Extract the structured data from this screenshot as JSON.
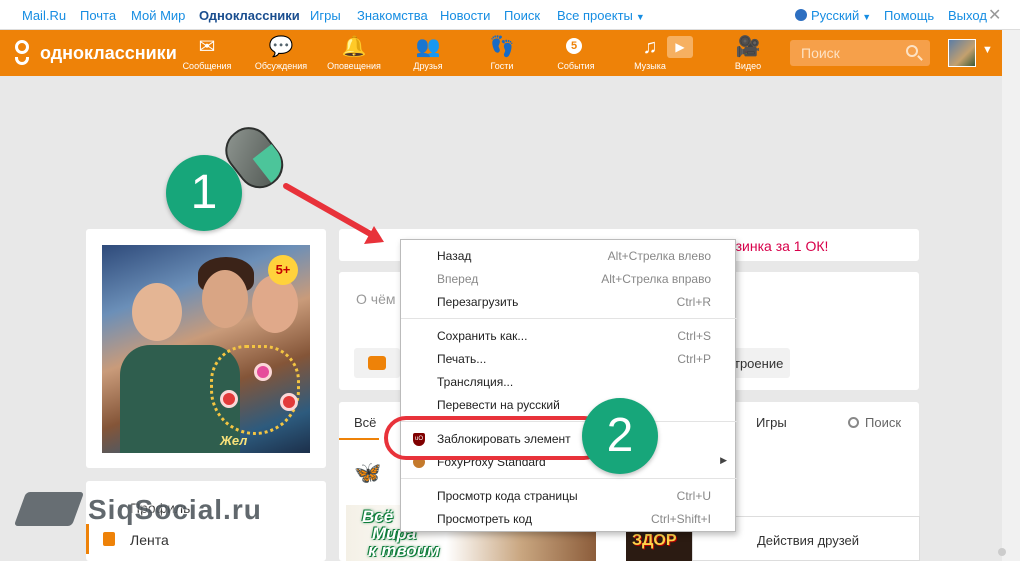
{
  "topbar": {
    "links": [
      "Mail.Ru",
      "Почта",
      "Мой Мир",
      "Одноклассники",
      "Игры",
      "Знакомства",
      "Новости",
      "Поиск",
      "Все проекты"
    ],
    "language": "Русский",
    "help": "Помощь",
    "logout": "Выход"
  },
  "okbar": {
    "brand": "одноклассники",
    "nav": [
      {
        "label": "Сообщения",
        "icon": "envelope-icon"
      },
      {
        "label": "Обсуждения",
        "icon": "chat-bubbles-icon"
      },
      {
        "label": "Оповещения",
        "icon": "bell-icon"
      },
      {
        "label": "Друзья",
        "icon": "friends-icon"
      },
      {
        "label": "Гости",
        "icon": "footprints-icon"
      },
      {
        "label": "События",
        "icon": "events-icon"
      },
      {
        "label": "Музыка",
        "icon": "music-note-icon"
      },
      {
        "label": "Видео",
        "icon": "video-camera-icon"
      }
    ],
    "events_badge": "5",
    "search_placeholder": "Поиск"
  },
  "profile": {
    "badge": "5+",
    "signature": "Жел",
    "menu": [
      "Профиль",
      "Лента"
    ]
  },
  "feed": {
    "promo": "рзинка за 1 ОК!",
    "status_placeholder": "О чём",
    "mood_btn": "троение",
    "tabs": [
      "Всё",
      "Игры"
    ],
    "search": "Поиск",
    "ad_text_lines": [
      "Всё",
      "Мира",
      "к твоим"
    ],
    "ad2_text": "ЗДОР",
    "friends_actions": "Действия друзей"
  },
  "context_menu": {
    "items": [
      {
        "label": "Назад",
        "shortcut": "Alt+Стрелка влево"
      },
      {
        "label": "Вперед",
        "shortcut": "Alt+Стрелка вправо",
        "disabled": true
      },
      {
        "label": "Перезагрузить",
        "shortcut": "Ctrl+R"
      },
      {
        "label": "Сохранить как...",
        "shortcut": "Ctrl+S"
      },
      {
        "label": "Печать...",
        "shortcut": "Ctrl+P"
      },
      {
        "label": "Трансляция...",
        "shortcut": ""
      },
      {
        "label": "Перевести на русский",
        "shortcut": ""
      },
      {
        "label": "Заблокировать элемент",
        "shortcut": "",
        "icon": "ublock-icon"
      },
      {
        "label": "FoxyProxy Standard",
        "shortcut": "",
        "icon": "foxyproxy-icon",
        "submenu": true
      },
      {
        "label": "Просмотр кода страницы",
        "shortcut": "Ctrl+U"
      },
      {
        "label": "Просмотреть код",
        "shortcut": "Ctrl+Shift+I"
      }
    ],
    "ublock_icon_text": "uO"
  },
  "annotations": {
    "step1": "1",
    "step2": "2"
  },
  "watermark": "SiqSocial.ru",
  "colors": {
    "ok_orange": "#ee8208",
    "mailru_blue": "#168de2",
    "annotation_green": "#17a67a",
    "annotation_red": "#e8323a"
  }
}
